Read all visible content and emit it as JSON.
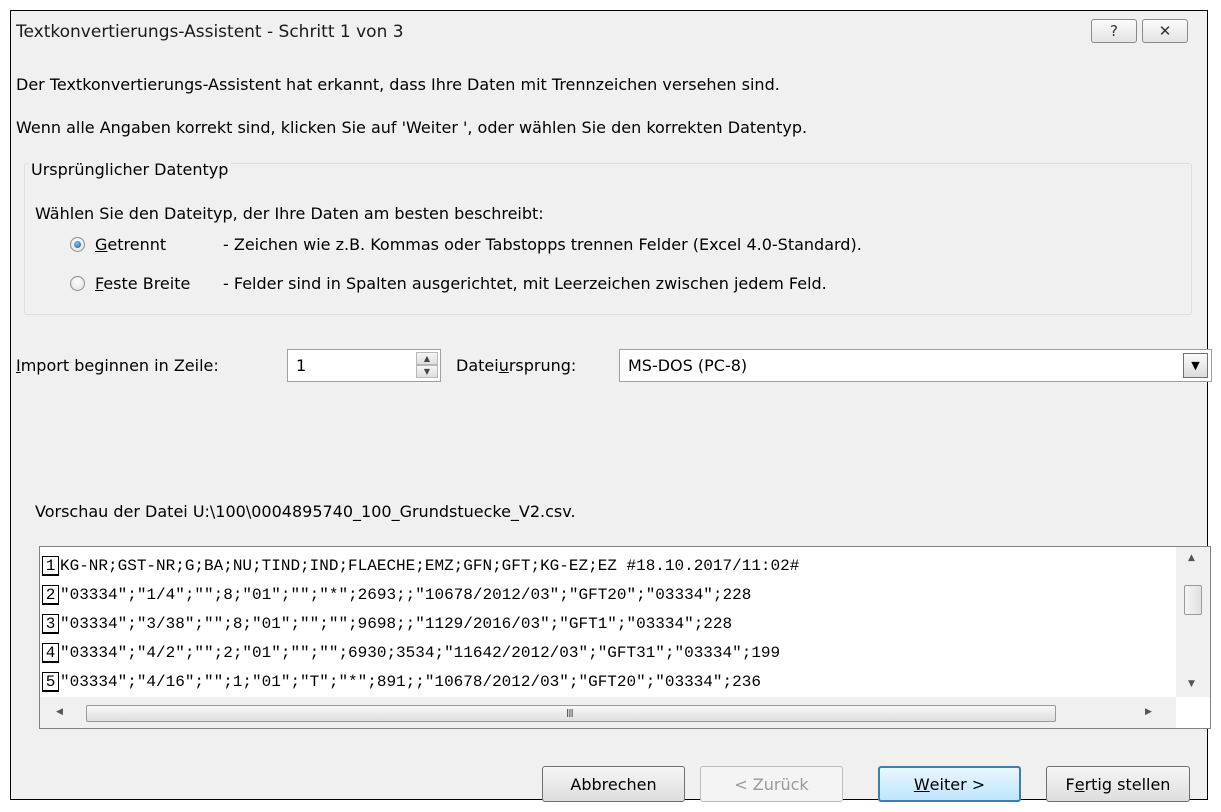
{
  "window": {
    "title": "Textkonvertierungs-Assistent - Schritt 1 von 3",
    "help_symbol": "?",
    "close_symbol": "✕"
  },
  "intro": {
    "line1": "Der Textkonvertierungs-Assistent hat erkannt, dass Ihre Daten mit Trennzeichen versehen sind.",
    "line2": "Wenn alle Angaben korrekt sind, klicken Sie auf 'Weiter ', oder wählen Sie den korrekten Datentyp."
  },
  "data_type_group": {
    "legend": "Ursprünglicher Datentyp",
    "prompt": "Wählen Sie den Dateityp, der Ihre Daten am besten beschreibt:",
    "options": [
      {
        "accel": "G",
        "rest": "etrennt",
        "description": "- Zeichen wie z.B. Kommas oder Tabstopps trennen Felder (Excel 4.0-Standard).",
        "selected": true
      },
      {
        "accel": "F",
        "rest": "este Breite",
        "description": "- Felder sind in Spalten ausgerichtet, mit Leerzeichen zwischen jedem Feld.",
        "selected": false
      }
    ]
  },
  "import_row": {
    "label_accel": "I",
    "label_rest": "mport beginnen in Zeile:",
    "value": "1",
    "origin_label_pre": "Datei",
    "origin_label_accel": "u",
    "origin_label_post": "rsprung:",
    "origin_value": "MS-DOS (PC-8)"
  },
  "preview": {
    "label": "Vorschau der Datei U:\\100\\0004895740_100_Grundstuecke_V2.csv.",
    "lines": [
      {
        "num": "1",
        "text": "KG-NR;GST-NR;G;BA;NU;TIND;IND;FLAECHE;EMZ;GFN;GFT;KG-EZ;EZ #18.10.2017/11:02#"
      },
      {
        "num": "2",
        "text": "\"03334\";\"1/4\";\"\";8;\"01\";\"\";\"*\";2693;;\"10678/2012/03\";\"GFT20\";\"03334\";228"
      },
      {
        "num": "3",
        "text": "\"03334\";\"3/38\";\"\";8;\"01\";\"\";\"\";9698;;\"1129/2016/03\";\"GFT1\";\"03334\";228"
      },
      {
        "num": "4",
        "text": "\"03334\";\"4/2\";\"\";2;\"01\";\"\";\"\";6930;3534;\"11642/2012/03\";\"GFT31\";\"03334\";199"
      },
      {
        "num": "5",
        "text": "\"03334\";\"4/16\";\"\";1;\"01\";\"T\";\"*\";891;;\"10678/2012/03\";\"GFT20\";\"03334\";236"
      }
    ],
    "grip": "III"
  },
  "buttons": {
    "cancel": "Abbrechen",
    "back": "< Zurück",
    "next_accel": "W",
    "next_rest": "eiter >",
    "finish_pre": "F",
    "finish_accel": "e",
    "finish_post": "rtig stellen"
  }
}
